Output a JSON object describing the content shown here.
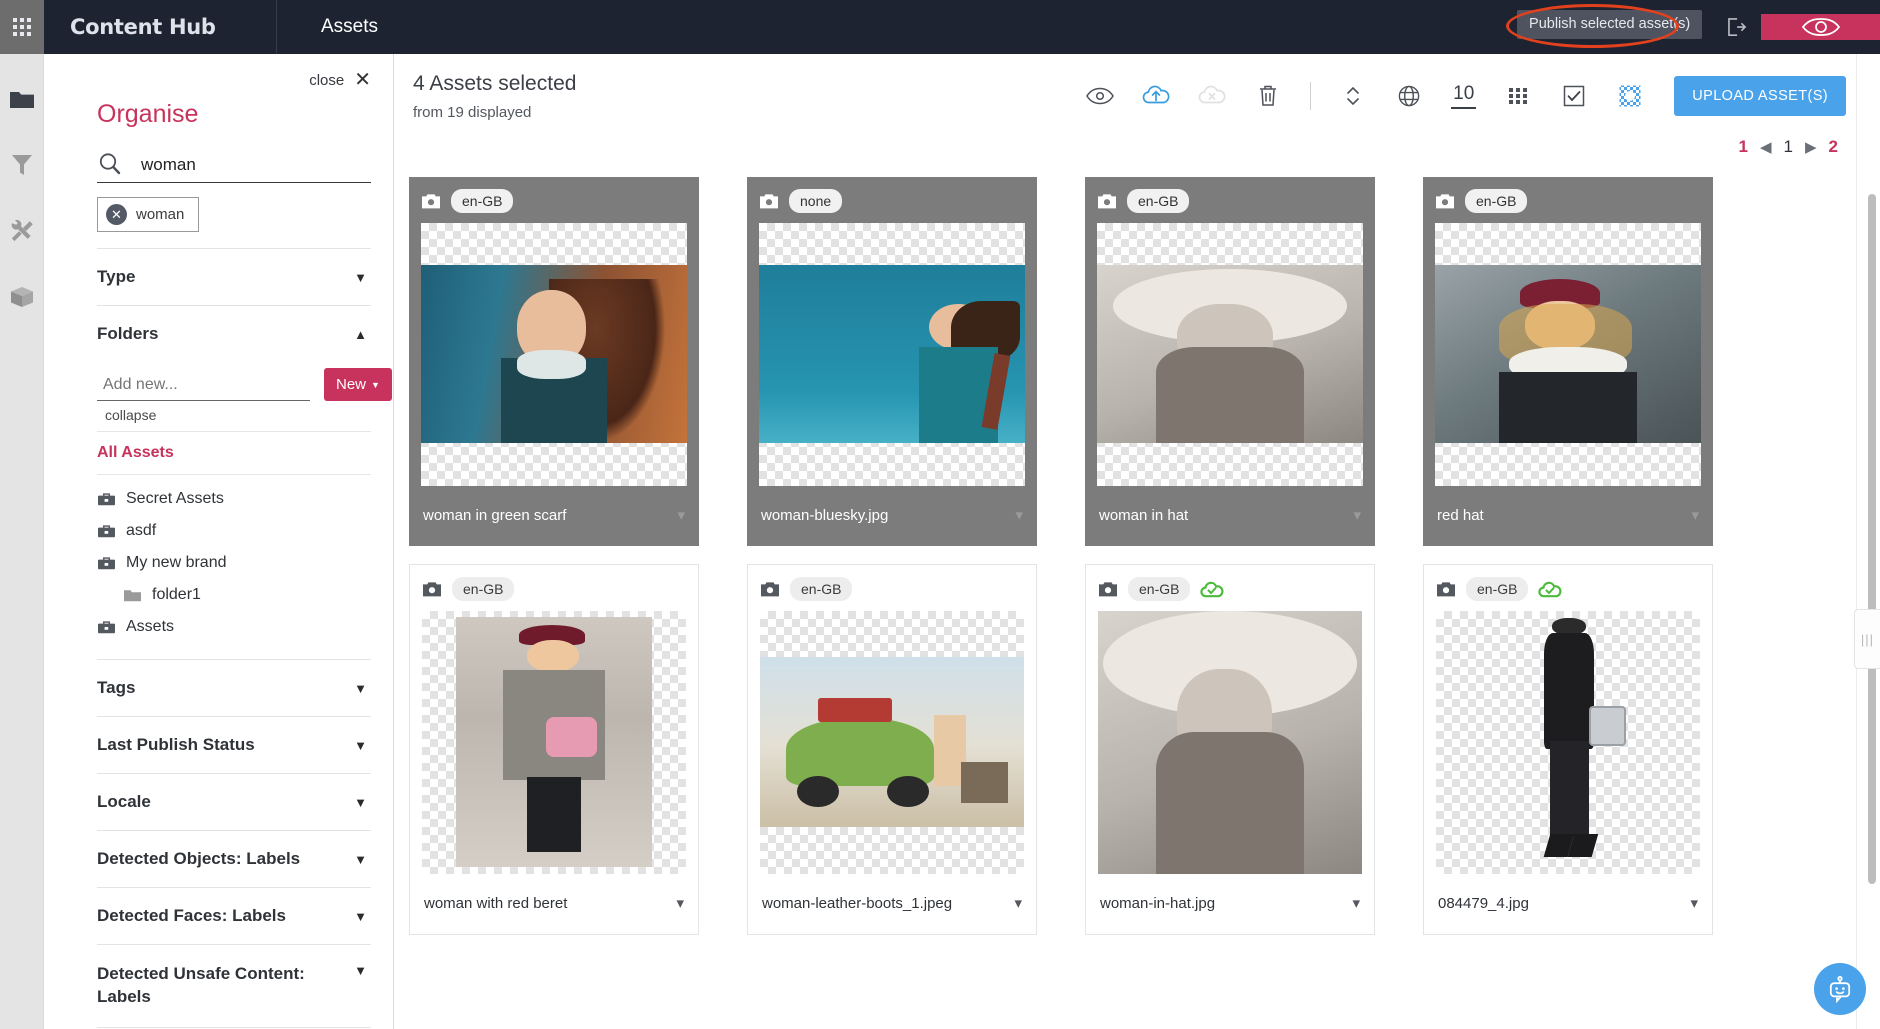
{
  "topbar": {
    "brand": "Content Hub",
    "section": "Assets",
    "tooltip": "Publish selected asset(s)",
    "icons": [
      "waffle-icon",
      "help-icon",
      "gear-icon",
      "logout-icon",
      "eye-icon"
    ],
    "annotation_color": "#e2411e",
    "bg_color": "#1d2330",
    "eye_panel_color": "#c7335c"
  },
  "rail": {
    "items": [
      {
        "icon": "folder-icon",
        "active": true
      },
      {
        "icon": "filter-funnel-icon",
        "active": false
      },
      {
        "icon": "tools-icon",
        "active": false
      },
      {
        "icon": "box-icon",
        "active": false
      }
    ]
  },
  "organise": {
    "close_label": "close",
    "title": "Organise",
    "accent_color": "#c7335c",
    "search": {
      "value": "woman",
      "placeholder": ""
    },
    "chip": {
      "label": "woman"
    },
    "sections": [
      {
        "label": "Type",
        "expanded": false
      },
      {
        "label": "Folders",
        "expanded": true
      },
      {
        "label": "Tags",
        "expanded": false
      },
      {
        "label": "Last Publish Status",
        "expanded": false
      },
      {
        "label": "Locale",
        "expanded": false
      },
      {
        "label": "Detected Objects: Labels",
        "expanded": false
      },
      {
        "label": "Detected Faces: Labels",
        "expanded": false
      },
      {
        "label": "Detected Unsafe Content: Labels",
        "expanded": false
      }
    ],
    "folders": {
      "add_placeholder": "Add new...",
      "new_button": "New",
      "collapse_link": "collapse",
      "all_assets": "All Assets",
      "tree": [
        {
          "label": "Secret Assets",
          "icon": "brand-icon",
          "indent": false
        },
        {
          "label": "asdf",
          "icon": "brand-icon",
          "indent": false
        },
        {
          "label": "My new brand",
          "icon": "brand-icon",
          "indent": false
        },
        {
          "label": "folder1",
          "icon": "folder-icon",
          "indent": true
        },
        {
          "label": "Assets",
          "icon": "brand-icon",
          "indent": false
        }
      ]
    }
  },
  "main": {
    "selected_title": "4 Assets selected",
    "selected_sub": "from 19 displayed",
    "tools": [
      {
        "name": "preview-eye-icon",
        "state": "normal"
      },
      {
        "name": "publish-cloud-upload-icon",
        "state": "active"
      },
      {
        "name": "unpublish-cloud-x-icon",
        "state": "disabled"
      },
      {
        "name": "delete-trash-icon",
        "state": "normal"
      },
      {
        "name": "sort-updown-icon",
        "state": "normal"
      },
      {
        "name": "globe-icon",
        "state": "normal"
      },
      {
        "name": "grid-view-icon",
        "state": "normal"
      },
      {
        "name": "select-all-checkbox-icon",
        "state": "normal"
      },
      {
        "name": "transparency-icon",
        "state": "active"
      }
    ],
    "page_size": "10",
    "upload_button": "UPLOAD ASSET(S)",
    "pagination": {
      "first": "1",
      "prev": "◀",
      "current": "1",
      "next": "▶",
      "last": "2"
    }
  },
  "assets": [
    {
      "locale": "en-GB",
      "name": "woman in green scarf",
      "selected": true,
      "published": false,
      "art": "green-scarf"
    },
    {
      "locale": "none",
      "name": "woman-bluesky.jpg",
      "selected": true,
      "published": false,
      "art": "bluesky"
    },
    {
      "locale": "en-GB",
      "name": "woman in hat",
      "selected": true,
      "published": false,
      "art": "hat-bw"
    },
    {
      "locale": "en-GB",
      "name": "red hat",
      "selected": true,
      "published": false,
      "art": "red-beret-street"
    },
    {
      "locale": "en-GB",
      "name": "woman with red beret",
      "selected": false,
      "published": false,
      "art": "red-beret-coat"
    },
    {
      "locale": "en-GB",
      "name": "woman-leather-boots_1.jpeg",
      "selected": false,
      "published": false,
      "art": "beetle-car"
    },
    {
      "locale": "en-GB",
      "name": "woman-in-hat.jpg",
      "selected": false,
      "published": true,
      "art": "hat-bw2"
    },
    {
      "locale": "en-GB",
      "name": "084479_4.jpg",
      "selected": false,
      "published": true,
      "art": "black-dress"
    }
  ],
  "chatbot": {
    "icon": "chatbot-icon",
    "color": "#4aa3ea"
  }
}
